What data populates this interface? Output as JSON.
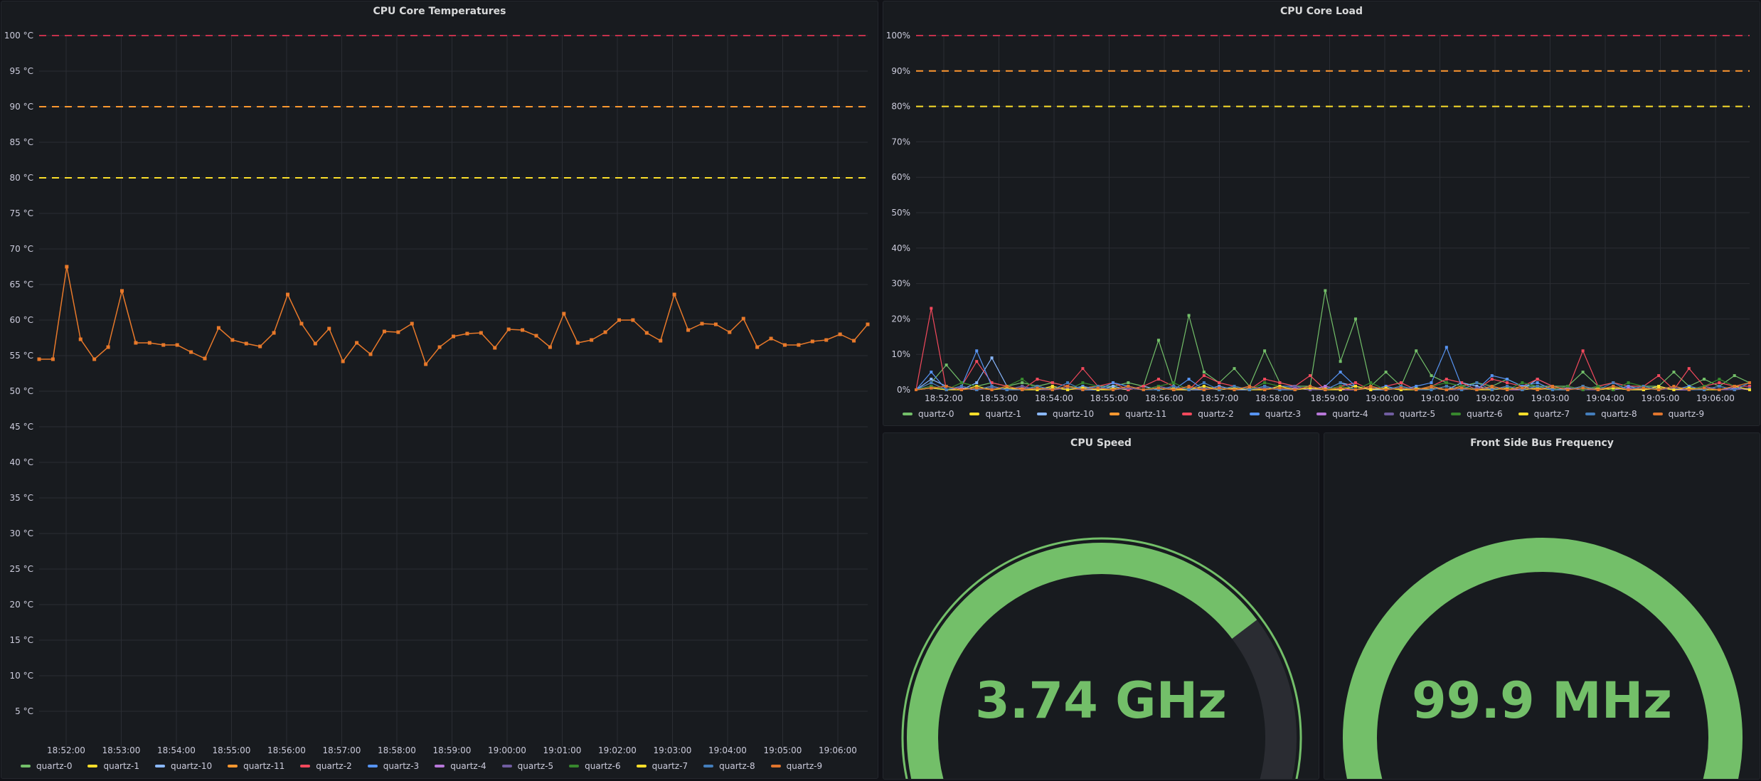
{
  "colors": {
    "background": "#111217",
    "panel": "#181b1f",
    "grid": "#2a2d33",
    "threshold_red": "#c4314b",
    "threshold_orange": "#ff9830",
    "threshold_yellow": "#fade2a",
    "gauge_green": "#73bf69",
    "gauge_track": "#2a2c32",
    "temperature_line": "#e8792a"
  },
  "series_colors": {
    "quartz-0": "#73bf69",
    "quartz-1": "#fade2a",
    "quartz-10": "#8ab8ff",
    "quartz-11": "#ff9830",
    "quartz-2": "#f2495c",
    "quartz-3": "#5794f2",
    "quartz-4": "#b877d9",
    "quartz-5": "#705da0",
    "quartz-6": "#37872d",
    "quartz-7": "#fade2a",
    "quartz-8": "#447ebc",
    "quartz-9": "#e0752d"
  },
  "legend": [
    "quartz-0",
    "quartz-1",
    "quartz-10",
    "quartz-11",
    "quartz-2",
    "quartz-3",
    "quartz-4",
    "quartz-5",
    "quartz-6",
    "quartz-7",
    "quartz-8",
    "quartz-9"
  ],
  "panels": {
    "temperatures": {
      "title": "CPU Core Temperatures"
    },
    "load": {
      "title": "CPU Core Load"
    },
    "cpu_speed": {
      "title": "CPU Speed",
      "value_text": "3.74 GHz",
      "fraction": 0.74
    },
    "fsb": {
      "title": "Front Side Bus Frequency",
      "value_text": "99.9 MHz",
      "fraction": 1.0
    }
  },
  "chart_data": [
    {
      "type": "line",
      "title": "CPU Core Temperatures",
      "y_unit": "°C",
      "ylim": [
        0,
        100
      ],
      "y_ticks": [
        "5 °C",
        "10 °C",
        "15 °C",
        "20 °C",
        "25 °C",
        "30 °C",
        "35 °C",
        "40 °C",
        "45 °C",
        "50 °C",
        "55 °C",
        "60 °C",
        "65 °C",
        "70 °C",
        "75 °C",
        "80 °C",
        "85 °C",
        "90 °C",
        "95 °C",
        "100 °C"
      ],
      "x_ticks": [
        "18:52:00",
        "18:53:00",
        "18:54:00",
        "18:55:00",
        "18:56:00",
        "18:57:00",
        "18:58:00",
        "18:59:00",
        "19:00:00",
        "19:01:00",
        "19:02:00",
        "19:03:00",
        "19:04:00",
        "19:05:00",
        "19:06:00"
      ],
      "thresholds": [
        {
          "value": 80,
          "color": "yellow"
        },
        {
          "value": 90,
          "color": "orange"
        },
        {
          "value": 100,
          "color": "red"
        }
      ],
      "grid": true,
      "legend_position": "bottom",
      "series": [
        {
          "name": "quartz-11",
          "values": [
            54.5,
            54.5,
            67.5,
            57.3,
            54.5,
            56.2,
            64.1,
            56.8,
            56.8,
            56.5,
            56.5,
            55.5,
            54.6,
            58.9,
            57.2,
            56.7,
            56.3,
            58.2,
            63.6,
            59.5,
            56.7,
            58.8,
            54.2,
            56.8,
            55.2,
            58.4,
            58.3,
            59.5,
            53.8,
            56.2,
            57.7,
            58.1,
            58.2,
            56.1,
            58.7,
            58.6,
            57.8,
            56.2,
            60.9,
            56.8,
            57.2,
            58.3,
            60.0,
            60.0,
            58.2,
            57.1,
            63.6,
            58.6,
            59.5,
            59.4,
            58.3,
            60.2,
            56.2,
            57.4,
            56.5,
            56.5,
            57.0,
            57.2,
            58.0,
            57.1,
            59.4
          ]
        }
      ]
    },
    {
      "type": "line",
      "title": "CPU Core Load",
      "y_unit": "%",
      "ylim": [
        0,
        100
      ],
      "y_ticks": [
        "0%",
        "10%",
        "20%",
        "30%",
        "40%",
        "50%",
        "60%",
        "70%",
        "80%",
        "90%",
        "100%"
      ],
      "x_ticks": [
        "18:52:00",
        "18:53:00",
        "18:54:00",
        "18:55:00",
        "18:56:00",
        "18:57:00",
        "18:58:00",
        "18:59:00",
        "19:00:00",
        "19:01:00",
        "19:02:00",
        "19:03:00",
        "19:04:00",
        "19:05:00",
        "19:06:00"
      ],
      "thresholds": [
        {
          "value": 80,
          "color": "yellow"
        },
        {
          "value": 90,
          "color": "orange"
        },
        {
          "value": 100,
          "color": "red"
        }
      ],
      "grid": true,
      "legend_position": "bottom",
      "series": [
        {
          "name": "quartz-0",
          "values": [
            0,
            2,
            7,
            2,
            1,
            2,
            1,
            2,
            1,
            2,
            1,
            0.5,
            1,
            1,
            2,
            1,
            14,
            1,
            21,
            5,
            2,
            6,
            1,
            11,
            2,
            1,
            1,
            28,
            8,
            20,
            1,
            5,
            1,
            11,
            4,
            2,
            1,
            2,
            1,
            3,
            1,
            1,
            1,
            1,
            5,
            1,
            2,
            1,
            1,
            1,
            5,
            1,
            3,
            1,
            4,
            2
          ]
        },
        {
          "name": "quartz-1",
          "values": [
            0,
            0.5,
            0,
            0.5,
            0,
            1,
            0,
            0.5,
            0,
            0.5,
            0,
            1,
            0,
            0.5,
            0,
            1,
            0,
            0.5,
            0,
            0.5,
            0,
            1,
            0,
            0.5,
            0,
            0.5,
            0,
            0.5,
            0,
            1,
            0,
            0.5,
            0,
            0.5,
            0,
            1,
            0,
            0.5,
            0,
            0.5,
            0,
            1,
            0,
            0.5,
            0,
            0.5,
            0,
            1,
            0,
            0.5,
            0,
            0.5,
            0,
            1,
            0,
            0.5
          ]
        },
        {
          "name": "quartz-10",
          "values": [
            0,
            3,
            1,
            0,
            2,
            9,
            1,
            0,
            1,
            0,
            1,
            0,
            0,
            1,
            0,
            1,
            0,
            1,
            0,
            0,
            1,
            0,
            0,
            1,
            0,
            0,
            1,
            0,
            2,
            1,
            0,
            0,
            1,
            0,
            1,
            0,
            2,
            1,
            0,
            1,
            0,
            3,
            1,
            0,
            1,
            0,
            1,
            0,
            0,
            1,
            0,
            0,
            1,
            0,
            1,
            0
          ]
        },
        {
          "name": "quartz-11",
          "values": [
            0,
            1,
            0,
            0.5,
            0,
            1,
            0,
            0.5,
            0,
            1,
            0,
            0.5,
            1,
            0,
            0.5,
            0,
            1,
            0,
            0.5,
            0,
            1,
            0,
            0.5,
            0,
            1,
            0,
            0.5,
            0,
            1,
            0,
            0.5,
            0,
            1,
            0,
            0.5,
            0,
            1,
            0,
            0.5,
            0,
            1,
            0,
            0.5,
            0,
            1,
            0,
            0.5,
            0,
            1,
            0,
            0.5,
            0,
            1,
            0,
            0.5,
            0
          ]
        },
        {
          "name": "quartz-2",
          "values": [
            0,
            23,
            0,
            1,
            8,
            2,
            1,
            0,
            3,
            2,
            1,
            6,
            1,
            2,
            0,
            1,
            3,
            1,
            0,
            4,
            2,
            1,
            0,
            3,
            2,
            1,
            4,
            0,
            1,
            2,
            0,
            1,
            2,
            0,
            1,
            3,
            2,
            0,
            3,
            2,
            1,
            3,
            1,
            0,
            11,
            1,
            2,
            1,
            1,
            4,
            0,
            6,
            1,
            2,
            1,
            1
          ]
        },
        {
          "name": "quartz-3",
          "values": [
            0,
            5,
            0,
            1,
            11,
            1,
            0,
            1,
            0,
            1,
            0,
            1,
            0,
            2,
            1,
            0,
            1,
            0,
            3,
            0,
            1,
            0,
            1,
            0,
            1,
            1,
            0,
            1,
            5,
            1,
            0,
            1,
            0,
            1,
            2,
            12,
            1,
            0,
            4,
            3,
            1,
            2,
            0,
            1,
            0,
            1,
            0,
            1,
            0,
            1,
            0,
            1,
            0,
            1,
            0,
            2
          ]
        },
        {
          "name": "quartz-4",
          "values": [
            0,
            1,
            0,
            0.5,
            0,
            1,
            0,
            0,
            1,
            0,
            0.5,
            0,
            1,
            0,
            0.5,
            0,
            1,
            0,
            0,
            1,
            0,
            0.5,
            0,
            1,
            0,
            0.5,
            0,
            1,
            0,
            0,
            1,
            0,
            0.5,
            0,
            1,
            0,
            0.5,
            0,
            1,
            0,
            0,
            1,
            0,
            0.5,
            0,
            1,
            0,
            0.5,
            0,
            1,
            0,
            0,
            1,
            0,
            0.5,
            0
          ]
        },
        {
          "name": "quartz-5",
          "values": [
            0,
            0.5,
            0,
            1,
            0,
            0.5,
            0,
            1,
            0,
            0,
            0.5,
            0,
            1,
            0,
            0.5,
            0,
            1,
            0,
            0,
            0.5,
            0,
            1,
            0,
            0.5,
            0,
            1,
            0,
            0,
            0.5,
            0,
            1,
            0,
            0.5,
            0,
            1,
            0,
            0,
            0.5,
            0,
            1,
            0,
            0.5,
            0,
            1,
            0,
            0,
            0.5,
            0,
            1,
            0,
            0.5,
            0,
            1,
            0,
            0,
            0.5
          ]
        },
        {
          "name": "quartz-6",
          "values": [
            0,
            1,
            0,
            2,
            1,
            0,
            1,
            3,
            0,
            1,
            0,
            2,
            1,
            0,
            1,
            0,
            1,
            2,
            0,
            1,
            0,
            1,
            0,
            2,
            1,
            0,
            1,
            0,
            1,
            0,
            2,
            0,
            1,
            0,
            1,
            2,
            1,
            0,
            1,
            0,
            2,
            1,
            0,
            1,
            0,
            1,
            0,
            2,
            1,
            0,
            1,
            0,
            1,
            3,
            1,
            2
          ]
        },
        {
          "name": "quartz-7",
          "values": [
            0,
            0.5,
            0,
            0,
            1,
            0,
            0.5,
            0,
            0,
            1,
            0,
            0.5,
            0,
            0,
            1,
            0,
            0.5,
            0,
            0,
            1,
            0,
            0.5,
            0,
            0,
            1,
            0,
            0.5,
            0,
            0,
            1,
            0,
            0.5,
            0,
            0,
            1,
            0,
            0.5,
            0,
            0,
            1,
            0,
            0.5,
            0,
            0,
            1,
            0,
            0.5,
            0,
            0,
            1,
            0,
            0.5,
            0,
            0,
            1,
            0
          ]
        },
        {
          "name": "quartz-8",
          "values": [
            0,
            2,
            0,
            1,
            0,
            1,
            0,
            0,
            1,
            0,
            2,
            0,
            1,
            0,
            1,
            0,
            0,
            1,
            0,
            2,
            0,
            1,
            0,
            1,
            0,
            0,
            1,
            0,
            2,
            0,
            1,
            0,
            1,
            0,
            0,
            1,
            0,
            2,
            0,
            1,
            0,
            1,
            0,
            0,
            1,
            0,
            2,
            0,
            1,
            0,
            1,
            0,
            0,
            1,
            0,
            2
          ]
        },
        {
          "name": "quartz-9",
          "values": [
            0,
            0.5,
            1,
            0,
            0.5,
            0,
            1,
            0,
            0.5,
            0,
            1,
            0,
            0.5,
            0,
            1,
            0,
            0.5,
            0,
            1,
            0,
            0.5,
            0,
            1,
            0,
            0.5,
            0,
            1,
            0,
            0.5,
            0,
            1,
            0,
            0.5,
            0,
            1,
            0,
            0.5,
            0,
            1,
            0,
            0.5,
            0,
            1,
            0,
            0.5,
            0,
            1,
            0,
            0.5,
            0,
            1,
            0,
            0.5,
            0,
            1,
            2
          ]
        }
      ]
    }
  ]
}
